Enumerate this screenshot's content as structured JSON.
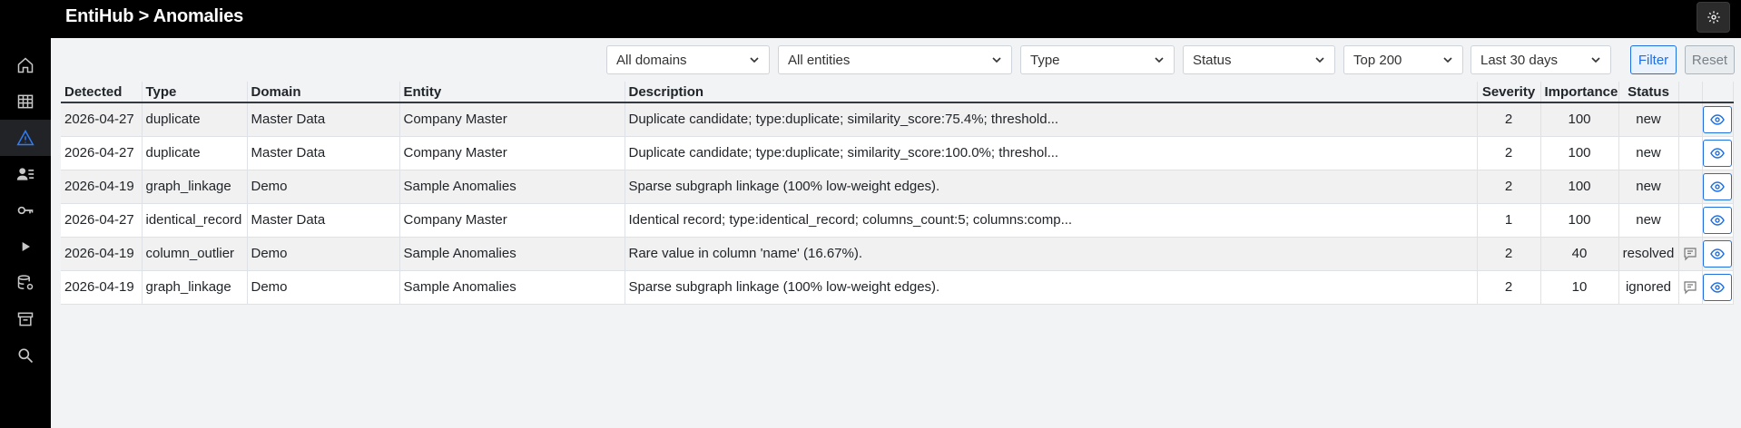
{
  "header": {
    "title": "EntiHub > Anomalies"
  },
  "sidebar": {
    "items": [
      {
        "name": "home",
        "icon": "home-icon"
      },
      {
        "name": "tables",
        "icon": "table-icon"
      },
      {
        "name": "anomalies",
        "icon": "warning-icon",
        "active": true
      },
      {
        "name": "people",
        "icon": "people-list-icon"
      },
      {
        "name": "keys",
        "icon": "key-icon"
      },
      {
        "name": "run",
        "icon": "play-icon"
      },
      {
        "name": "datasources",
        "icon": "database-settings-icon"
      },
      {
        "name": "archive",
        "icon": "archive-icon"
      },
      {
        "name": "search",
        "icon": "search-icon"
      }
    ]
  },
  "filters": {
    "domains": "All domains",
    "entities": "All entities",
    "type": "Type",
    "status": "Status",
    "top": "Top 200",
    "period": "Last 30 days",
    "filter_label": "Filter",
    "reset_label": "Reset"
  },
  "table": {
    "columns": [
      "Detected",
      "Type",
      "Domain",
      "Entity",
      "Description",
      "Severity",
      "Importance",
      "Status",
      "",
      ""
    ],
    "rows": [
      {
        "detected": "2026-04-27",
        "type": "duplicate",
        "domain": "Master Data",
        "entity": "Company Master",
        "description": "Duplicate candidate; type:duplicate; similarity_score:75.4%; threshold...",
        "severity": "2",
        "importance": "100",
        "status": "new",
        "comment": false
      },
      {
        "detected": "2026-04-27",
        "type": "duplicate",
        "domain": "Master Data",
        "entity": "Company Master",
        "description": "Duplicate candidate; type:duplicate; similarity_score:100.0%; threshol...",
        "severity": "2",
        "importance": "100",
        "status": "new",
        "comment": false
      },
      {
        "detected": "2026-04-19",
        "type": "graph_linkage",
        "domain": "Demo",
        "entity": "Sample Anomalies",
        "description": "Sparse subgraph linkage (100% low-weight edges).",
        "severity": "2",
        "importance": "100",
        "status": "new",
        "comment": false
      },
      {
        "detected": "2026-04-27",
        "type": "identical_record",
        "domain": "Master Data",
        "entity": "Company Master",
        "description": "Identical record; type:identical_record; columns_count:5; columns:comp...",
        "severity": "1",
        "importance": "100",
        "status": "new",
        "comment": false
      },
      {
        "detected": "2026-04-19",
        "type": "column_outlier",
        "domain": "Demo",
        "entity": "Sample Anomalies",
        "description": "Rare value in column 'name' (16.67%).",
        "severity": "2",
        "importance": "40",
        "status": "resolved",
        "comment": true
      },
      {
        "detected": "2026-04-19",
        "type": "graph_linkage",
        "domain": "Demo",
        "entity": "Sample Anomalies",
        "description": "Sparse subgraph linkage (100% low-weight edges).",
        "severity": "2",
        "importance": "10",
        "status": "ignored",
        "comment": true
      }
    ]
  },
  "colors": {
    "accent": "#1f6fe0",
    "topbar": "#000000",
    "background": "#f1f3f5"
  }
}
